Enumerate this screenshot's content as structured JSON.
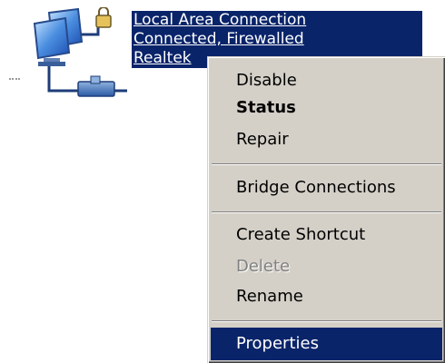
{
  "connection": {
    "icon": "network-connection-icon",
    "lines": [
      "Local Area Connection",
      "Connected, Firewalled",
      "Realtek"
    ]
  },
  "context_menu": {
    "items": [
      {
        "label": "Disable"
      },
      {
        "label": "Status"
      },
      {
        "label": "Repair"
      },
      {
        "label": "Bridge Connections"
      },
      {
        "label": "Create Shortcut"
      },
      {
        "label": "Delete",
        "disabled": true
      },
      {
        "label": "Rename"
      },
      {
        "label": "Properties",
        "selected": true
      }
    ]
  },
  "colors": {
    "selection": "#0a246a",
    "menu_background": "#d4d0c8",
    "disabled_text": "#808080"
  }
}
